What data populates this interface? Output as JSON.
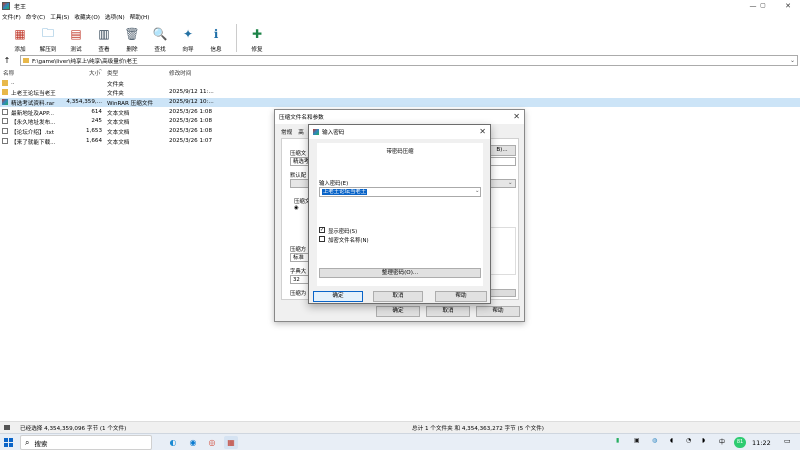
{
  "window": {
    "title": "老王",
    "controls": {
      "minimize": "—",
      "maximize": "▢",
      "close": "✕"
    }
  },
  "menu": [
    "文件(F)",
    "命令(C)",
    "工具(S)",
    "收藏夹(O)",
    "选项(N)",
    "帮助(H)"
  ],
  "toolbar": [
    {
      "label": "添加",
      "icon": "add-archive-icon",
      "glyph": "▦",
      "color": "#c0392b"
    },
    {
      "label": "解压到",
      "icon": "extract-folder-icon",
      "glyph": "🗀",
      "color": "#2e86c1"
    },
    {
      "label": "测试",
      "icon": "test-icon",
      "glyph": "▤",
      "color": "#c0392b"
    },
    {
      "label": "查看",
      "icon": "view-book-icon",
      "glyph": "▥",
      "color": "#2c3e50"
    },
    {
      "label": "删除",
      "icon": "trash-icon",
      "glyph": "🗑",
      "color": "#566573"
    },
    {
      "label": "查找",
      "icon": "magnifier-icon",
      "glyph": "🔍",
      "color": "#1f6fa8"
    },
    {
      "label": "向导",
      "icon": "wizard-wand-icon",
      "glyph": "✦",
      "color": "#2471a3"
    },
    {
      "label": "信息",
      "icon": "info-icon",
      "glyph": "ℹ",
      "color": "#1f6fa8"
    },
    {
      "label": "修复",
      "icon": "repair-icon",
      "glyph": "✚",
      "color": "#1e8449"
    }
  ],
  "path": {
    "up": "↑",
    "value": "F:\\game\\liver\\纯享上\\纯享\\高级量价\\老王",
    "dropdown": "⌄"
  },
  "list": {
    "headers": [
      "名称",
      "大小",
      "类型",
      "修改时间"
    ],
    "sort_indicator": "^",
    "rows": [
      {
        "name": "..",
        "size": "",
        "type": "文件夹",
        "modified": "",
        "icon": "parent-folder-icon"
      },
      {
        "name": "上老王论坛当老王",
        "size": "",
        "type": "文件夹",
        "modified": "2025/9/12 11:...",
        "icon": "folder-icon"
      },
      {
        "name": "精选考试资料.rar",
        "size": "4,354,359,...",
        "type": "WinRAR 压缩文件",
        "modified": "2025/9/12 10:...",
        "icon": "rar-icon"
      },
      {
        "name": "最新地址及APP...",
        "size": "614",
        "type": "文本文档",
        "modified": "2025/3/26 1:08",
        "icon": "text-file-icon"
      },
      {
        "name": "【永久地址发布...",
        "size": "245",
        "type": "文本文档",
        "modified": "2025/3/26 1:08",
        "icon": "text-file-icon"
      },
      {
        "name": "【论坛介绍】.txt",
        "size": "1,653",
        "type": "文本文档",
        "modified": "2025/3/26 1:08",
        "icon": "text-file-icon"
      },
      {
        "name": "【来了就能下载...",
        "size": "1,664",
        "type": "文本文档",
        "modified": "2025/3/26 1:07",
        "icon": "text-file-icon"
      }
    ]
  },
  "archive_dialog": {
    "title": "压缩文件名和参数",
    "close": "✕",
    "tabs": [
      "常规",
      "高"
    ],
    "labels": {
      "archive_name": "压缩文",
      "default_profile": "默认配",
      "format": "压缩文",
      "method": "压缩方",
      "dict": "字典大",
      "split": "压缩为"
    },
    "fields": {
      "name_value": "精选考",
      "method_value": "标准",
      "dict_value": "32",
      "browse_btn": "B)...",
      "chev": "⌄"
    },
    "buttons": {
      "ok": "确定",
      "cancel": "取消",
      "help": "帮助"
    }
  },
  "password_dialog": {
    "title": "输入密码",
    "close": "✕",
    "heading": "带密码压缩",
    "password_label": "输入密码(E)",
    "password_value": "上老王论坛当老王",
    "show_password": {
      "label": "显示密码(S)",
      "checked": true,
      "mark": "✓"
    },
    "encrypt_names": {
      "label": "加密文件名称(N)",
      "checked": false
    },
    "manage_btn": "整理密码(O)...",
    "buttons": {
      "ok": "确定",
      "cancel": "取消",
      "help": "帮助"
    }
  },
  "status": {
    "left": "已经选择 4,354,359,096 字节 (1 个文件)",
    "right": "总计 1 个文件夹 和 4,354,363,272 字节 (5 个文件)"
  },
  "taskbar": {
    "search_placeholder": "搜索",
    "search_glyph": "⌕",
    "time": "11:22",
    "tray_badge": "81",
    "apps": [
      {
        "name": "edge-icon",
        "glyph": "◐",
        "color": "#1b8ad2"
      },
      {
        "name": "mail-icon",
        "glyph": "◉",
        "color": "#0a7bd1"
      },
      {
        "name": "chrome-icon",
        "glyph": "◎",
        "color": "#d24b3a"
      },
      {
        "name": "winrar-taskbar-icon",
        "glyph": "▦",
        "color": "#c0392b"
      }
    ],
    "tray_icons": [
      {
        "name": "battery-tray-icon",
        "glyph": "▮"
      },
      {
        "name": "chat-tray-icon",
        "glyph": "▣"
      },
      {
        "name": "wechat-tray-icon",
        "glyph": "◍"
      },
      {
        "name": "volume-tray-icon",
        "glyph": "◖"
      },
      {
        "name": "network-tray-icon",
        "glyph": "◔"
      },
      {
        "name": "speaker-tray-icon",
        "glyph": "◗"
      },
      {
        "name": "ime-tray-icon",
        "glyph": "中"
      }
    ]
  }
}
